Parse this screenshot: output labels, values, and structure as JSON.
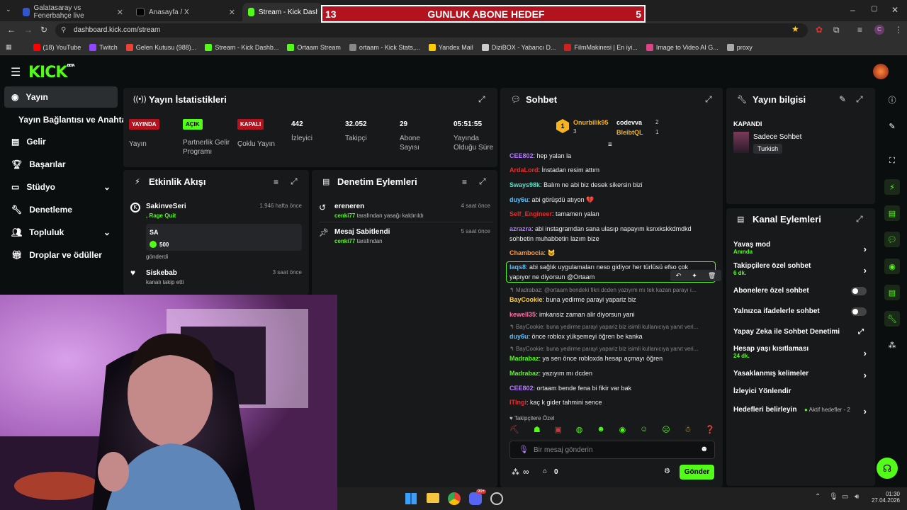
{
  "browser": {
    "tabs": [
      {
        "label": "Galatasaray vs Fenerbahçe live",
        "color": "#3355cc"
      },
      {
        "label": "Anasayfa / X",
        "color": "#000000"
      },
      {
        "label": "Stream - Kick Dashboard",
        "color": "#53fc18"
      }
    ],
    "url": "dashboard.kick.com/stream",
    "bookmarks": [
      {
        "label": "(18) YouTube",
        "color": "#ff0000"
      },
      {
        "label": "Twitch",
        "color": "#9146ff"
      },
      {
        "label": "Gelen Kutusu (988)...",
        "color": "#ea4335"
      },
      {
        "label": "Stream - Kick Dashb...",
        "color": "#53fc18"
      },
      {
        "label": "Ortaam Stream",
        "color": "#53fc18"
      },
      {
        "label": "ortaam - Kick Stats,...",
        "color": "#888888"
      },
      {
        "label": "Yandex Mail",
        "color": "#ffcc00"
      },
      {
        "label": "DiziBOX - Yabancı D...",
        "color": "#cccccc"
      },
      {
        "label": "FilmMakinesi | En iyi...",
        "color": "#cc2222"
      },
      {
        "label": "Image to Video AI G...",
        "color": "#dd4488"
      },
      {
        "label": "proxy",
        "color": "#aaaaaa"
      }
    ]
  },
  "goal": {
    "left": "13",
    "title": "GUNLUK ABONE HEDEF",
    "right": "5"
  },
  "brand": {
    "logo": "KICK",
    "beta": "BETA",
    "accent": "#53fc18"
  },
  "sidebar": {
    "items": [
      {
        "label": "Yayın",
        "icon": "broadcast-icon"
      },
      {
        "label": "Yayın Bağlantısı ve Anahtarı",
        "icon": ""
      },
      {
        "label": "Gelir",
        "icon": "money-icon"
      },
      {
        "label": "Başarılar",
        "icon": "trophy-icon"
      },
      {
        "label": "Stüdyo",
        "icon": "studio-icon"
      },
      {
        "label": "Denetleme",
        "icon": "wrench-icon"
      },
      {
        "label": "Topluluk",
        "icon": "community-icon"
      },
      {
        "label": "Droplar ve ödüller",
        "icon": "gift-icon"
      }
    ]
  },
  "stats": {
    "title": "Yayın İstatistikleri",
    "items": [
      {
        "badge": "YAYINDA",
        "badge_color": "#b3121f",
        "label": "Yayın"
      },
      {
        "badge": "AÇIK",
        "badge_color": "#53fc18",
        "label": "Partnerlik Gelir Programı"
      },
      {
        "badge": "KAPALI",
        "badge_color": "#b3121f",
        "label": "Çoklu Yayın"
      },
      {
        "value": "442",
        "label": "İzleyici"
      },
      {
        "value": "32.052",
        "label": "Takipçi"
      },
      {
        "value": "29",
        "label": "Abone Sayısı"
      },
      {
        "value": "05:51:55",
        "label": "Yayında Olduğu Süre"
      }
    ]
  },
  "activity": {
    "title": "Etkinlik Akışı",
    "items": [
      {
        "user": "SakinveSeri",
        "sub": ", Rage Quit",
        "time": "1.946 hafta önce",
        "card_title": "SA",
        "card_amount": "500",
        "card_note": "gönderdi"
      },
      {
        "user": "Siskebab",
        "sub": "kanalı takip etti",
        "time": "3 saat önce"
      }
    ]
  },
  "moderation": {
    "title": "Denetim Eylemleri",
    "items": [
      {
        "user": "ereneren",
        "by": "cenki77",
        "desc": "tarafından yasağı kaldırıldı",
        "time": "4 saat önce"
      },
      {
        "user": "Mesaj Sabitlendi",
        "by": "cenki77",
        "desc": "tarafından",
        "time": "5 saat önce"
      }
    ]
  },
  "chat": {
    "title": "Sohbet",
    "top": [
      {
        "name": "Onurbilik95",
        "count": "3",
        "rank": "1"
      },
      {
        "name": "codevva",
        "count": "2"
      },
      {
        "name": "BleibtQL",
        "count": "1"
      }
    ],
    "messages": [
      {
        "name": "CEE802",
        "color": "#b57bff",
        "text": "hep yalan la"
      },
      {
        "name": "ArdaLord",
        "color": "#e03030",
        "text": "İnstadan resim attım"
      },
      {
        "name": "Sways98k",
        "color": "#53e3c8",
        "text": "Balım ne abi biz desek sikersin bizi"
      },
      {
        "name": "duy6u",
        "color": "#53c2ff",
        "text": "abi görüşdü atıyon 💔"
      },
      {
        "name": "Self_Engineer",
        "color": "#e03030",
        "text": "tamamen yalan"
      },
      {
        "name": "azrazra",
        "color": "#b57bff",
        "text": "abi instagramdan sana ulasıp napayım ksnxkskkdmdkd"
      },
      {
        "name": "",
        "color": "#fff",
        "text": "sohbetin muhabbetin lazım bize"
      },
      {
        "name": "Chambocia",
        "color": "#ff9a3c",
        "text": "🐱"
      },
      {
        "name": "laqs8",
        "color": "#53c2ff",
        "text": "abi sağlık uygulamaları neso gidiyor her türlüsü efso çok"
      },
      {
        "name": "",
        "color": "#fff",
        "text": "yapıyor ne diyorsun @Ortaam"
      },
      {
        "name": "BayCookie",
        "color": "#ffcc33",
        "text": "buna yedirme parayi yapariz biz"
      },
      {
        "name": "kewell35",
        "color": "#ff6fa6",
        "text": "imkansiz zaman alir diyorsun yani"
      },
      {
        "name": "duy6u",
        "color": "#53c2ff",
        "text": "önce roblox yükşemeyi öğren be kanka"
      },
      {
        "name": "Madrabaz",
        "color": "#53fc18",
        "text": "ya sen önce robloxda hesap açmayı öğren"
      },
      {
        "name": "Madrabaz",
        "color": "#53fc18",
        "text": "yazıyım mı dcden"
      },
      {
        "name": "CEE802",
        "color": "#b57bff",
        "text": "ortaam bende fena bi fikir var bak"
      },
      {
        "name": "ITIngi",
        "color": "#e03030",
        "text": "kaç k gider tahmini sence"
      }
    ],
    "replies": [
      "Madrabaz: @ortaam bendeki fikri dcden yazıyım mı tek kazan parayı i...",
      "BayCookie: buna yedirme parayi yapariz biz isimli kullanıcıya yanıt veri...",
      "BayCookie: buna yedirme parayi yapariz biz isimli kullanıcıya yanıt veri..."
    ],
    "followers_only": "Takipçilere Özel",
    "placeholder": "Bir mesaj gönderin",
    "infinity": "∞",
    "gift_count": "0",
    "send": "Gönder"
  },
  "stream_info": {
    "title": "Yayın bilgisi",
    "status": "KAPANDI",
    "name": "Sadece Sohbet",
    "lang": "Turkish"
  },
  "channel": {
    "title": "Kanal Eylemleri",
    "items": [
      {
        "label": "Yavaş mod",
        "sub": "Anında",
        "ctl": "chevron"
      },
      {
        "label": "Takipçilere özel sohbet",
        "sub": "6 dk.",
        "ctl": "chevron"
      },
      {
        "label": "Abonelere özel sohbet",
        "ctl": "toggle",
        "on": false
      },
      {
        "label": "Yalnızca ifadelerle sohbet",
        "ctl": "toggle",
        "on": false
      },
      {
        "label": "Yapay Zeka ile Sohbet Denetimi",
        "ctl": "external"
      },
      {
        "label": "Hesap yaşı kısıtlaması",
        "sub": "24 dk.",
        "ctl": "chevron"
      },
      {
        "label": "Yasaklanmış kelimeler",
        "ctl": "chevron"
      },
      {
        "label": "İzleyici Yönlendir",
        "ctl": ""
      },
      {
        "label": "Hedefleri belirleyin",
        "note": "Aktif hedefler - 2",
        "ctl": "chevron"
      }
    ]
  },
  "taskbar": {
    "time": "01:30",
    "date": "27.04.2026",
    "badge": "99+"
  }
}
